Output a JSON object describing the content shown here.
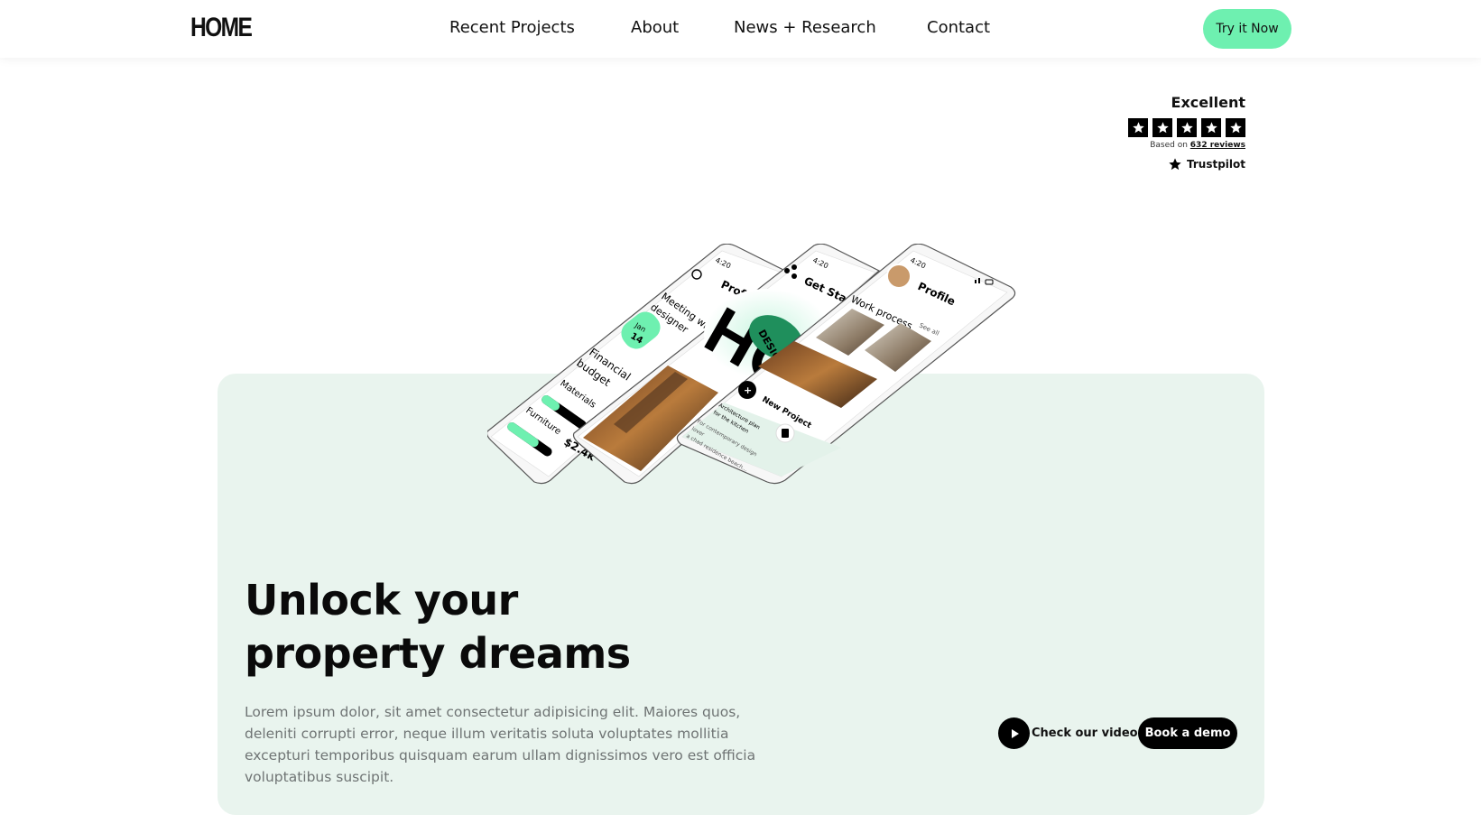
{
  "header": {
    "logo": "HOME",
    "nav": [
      {
        "label": "Recent Projects"
      },
      {
        "label": "About"
      },
      {
        "label": "News + Research"
      },
      {
        "label": "Contact"
      }
    ],
    "cta_label": "Try it Now"
  },
  "trust": {
    "rating_label": "Excellent",
    "stars": 5,
    "based_prefix": "Based on",
    "reviews_link": "632 reviews",
    "brand": "Trustpilot"
  },
  "phones": {
    "time": "4:20",
    "phone1": {
      "title": "Prof",
      "meeting": "Meeting wi",
      "meeting2": "designer",
      "date_month": "Jan",
      "date_day": "14",
      "budget": "Financial",
      "budget2": "budget",
      "materials": "Materials",
      "furniture": "Furniture",
      "amount": "$2.4k"
    },
    "phone2": {
      "title": "Get Sta",
      "logo_text": "HO",
      "badge": "DESIG"
    },
    "phone3": {
      "title": "Profile",
      "section": "Work process",
      "see_all": "See all",
      "new_project": "New Project",
      "desc1": "Architecture plan",
      "desc2": "for the kitchen",
      "desc3": "For contemporary design",
      "desc4": "lover",
      "desc5": "a chad residence beach..."
    }
  },
  "hero": {
    "title_line1": "Unlock your",
    "title_line2": "property dreams",
    "body": "Lorem ipsum dolor, sit amet consectetur adipisicing elit. Maiores quos, deleniti corrupti error, neque illum veritatis soluta voluptates mollitia excepturi temporibus quisquam earum ullam dignissimos vero est officia voluptatibus suscipit.",
    "video_label": "Check our video",
    "demo_label": "Book a demo"
  },
  "colors": {
    "accent": "#6ef0b0",
    "hero_bg": "#e9f4ee",
    "dark": "#000000"
  }
}
